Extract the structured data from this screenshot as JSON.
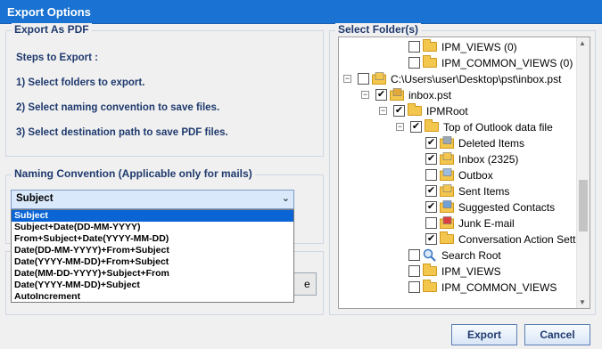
{
  "window": {
    "title": "Export Options"
  },
  "export_pdf": {
    "title": "Export As PDF",
    "steps_heading": "Steps to Export :",
    "steps": [
      "1) Select folders to export.",
      "2) Select naming convention to save files.",
      "3) Select destination path to save PDF files."
    ]
  },
  "naming": {
    "title": "Naming Convention (Applicable only for mails)",
    "selected": "Subject",
    "options": [
      "Subject",
      "Subject+Date(DD-MM-YYYY)",
      "From+Subject+Date(YYYY-MM-DD)",
      "Date(DD-MM-YYYY)+From+Subject",
      "Date(YYYY-MM-DD)+From+Subject",
      "Date(MM-DD-YYYY)+Subject+From",
      "Date(YYYY-MM-DD)+Subject",
      "AutoIncrement"
    ]
  },
  "browse_button_partial": "e",
  "folders": {
    "title": "Select Folder(s)",
    "tree": [
      {
        "label": "IPM_VIEWS (0)",
        "checked": false,
        "icon": "folder-icon"
      },
      {
        "label": "IPM_COMMON_VIEWS (0)",
        "checked": false,
        "icon": "folder-icon"
      },
      {
        "label": "C:\\Users\\user\\Desktop\\pst\\inbox.pst",
        "checked": false,
        "icon": "open-folder-icon",
        "expander": "-"
      },
      {
        "label": "inbox.pst",
        "checked": true,
        "icon": "pst-icon",
        "expander": "-"
      },
      {
        "label": "IPMRoot",
        "checked": true,
        "icon": "folder-icon",
        "expander": "-"
      },
      {
        "label": "Top of Outlook data file",
        "checked": true,
        "icon": "folder-icon",
        "expander": "-"
      },
      {
        "label": "Deleted Items",
        "checked": true,
        "icon": "deleted-items-icon"
      },
      {
        "label": "Inbox (2325)",
        "checked": true,
        "icon": "inbox-icon"
      },
      {
        "label": "Outbox",
        "checked": false,
        "icon": "outbox-icon"
      },
      {
        "label": "Sent Items",
        "checked": true,
        "icon": "sent-items-icon"
      },
      {
        "label": "Suggested Contacts",
        "checked": true,
        "icon": "contacts-icon"
      },
      {
        "label": "Junk E-mail",
        "checked": false,
        "icon": "junk-email-icon"
      },
      {
        "label": "Conversation Action Setti",
        "checked": true,
        "icon": "folder-icon"
      },
      {
        "label": "Search Root",
        "checked": false,
        "icon": "search-icon"
      },
      {
        "label": "IPM_VIEWS",
        "checked": false,
        "icon": "folder-icon"
      },
      {
        "label": "IPM_COMMON_VIEWS",
        "checked": false,
        "icon": "folder-icon"
      }
    ]
  },
  "buttons": {
    "export": "Export",
    "cancel": "Cancel"
  },
  "colors": {
    "titlebar": "#1a73d2",
    "selection": "#0a64d6",
    "group_title": "#1f3a6e"
  }
}
